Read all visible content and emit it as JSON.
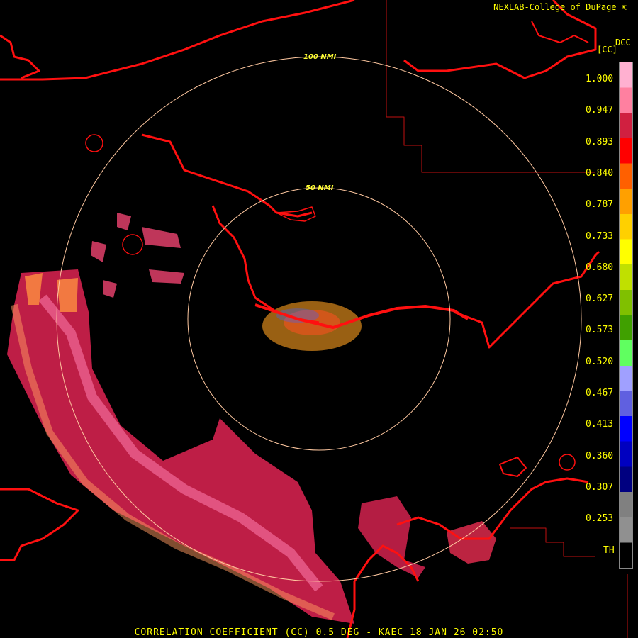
{
  "credit": "NEXLAB-College of DuPage",
  "credit_icon": "arrow-icon",
  "product_short": "DCC",
  "units": "[CC]",
  "ring_labels": [
    "100 NMI",
    "50 NMI"
  ],
  "footer": "CORRELATION COEFFICIENT (CC) 0.5 DEG - KAEC 18 JAN 26 02:50",
  "scale": {
    "labels": [
      "1.000",
      "0.947",
      "0.893",
      "0.840",
      "0.787",
      "0.733",
      "0.680",
      "0.627",
      "0.573",
      "0.520",
      "0.467",
      "0.413",
      "0.360",
      "0.307",
      "0.253",
      "TH"
    ],
    "colors": [
      "#ffb0d0",
      "#ff80a0",
      "#d02040",
      "#ff0000",
      "#ff6000",
      "#ffa000",
      "#ffd000",
      "#ffff00",
      "#c0e000",
      "#80c000",
      "#40a000",
      "#60ff60",
      "#a0a0ff",
      "#6060e0",
      "#0000ff",
      "#0000c0",
      "#000080",
      "#808080",
      "#909090",
      "#000000"
    ]
  },
  "colors": {
    "boundary": "#ff1010",
    "range_ring": "#ffc8a0",
    "text": "#ffff00"
  }
}
